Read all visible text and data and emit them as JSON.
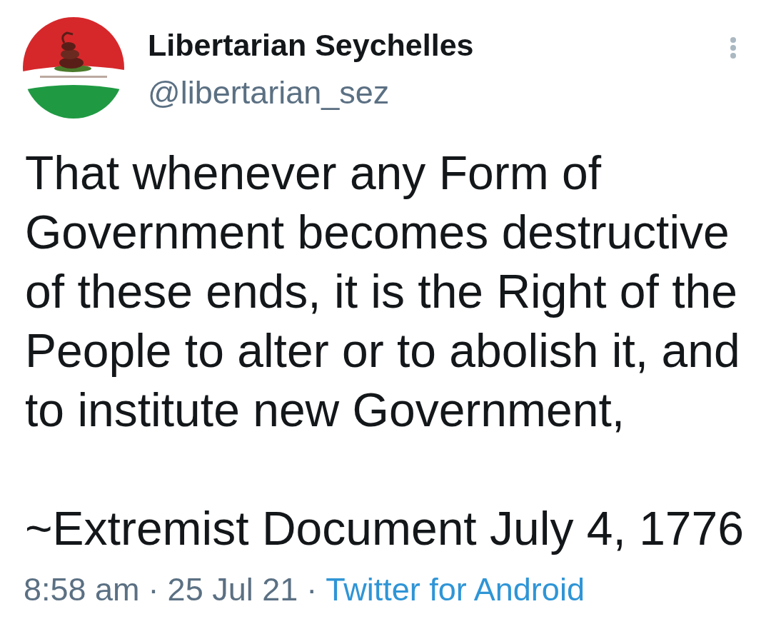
{
  "tweet": {
    "author": {
      "name": "Libertarian Seychelles",
      "handle": "@libertarian_sez"
    },
    "body": "That whenever any Form of Government becomes destructive of these ends, it is the Right of the People to alter or to abolish it, and to institute new Government,",
    "signature": "~Extremist Document July 4, 1776",
    "meta": [
      {
        "kind": "plain",
        "text": "8:58 am"
      },
      {
        "kind": "separator",
        "text": "·"
      },
      {
        "kind": "plain",
        "text": "25 Jul 21"
      },
      {
        "kind": "separator",
        "text": "·"
      },
      {
        "kind": "link",
        "text": "Twitter for Android"
      }
    ]
  }
}
